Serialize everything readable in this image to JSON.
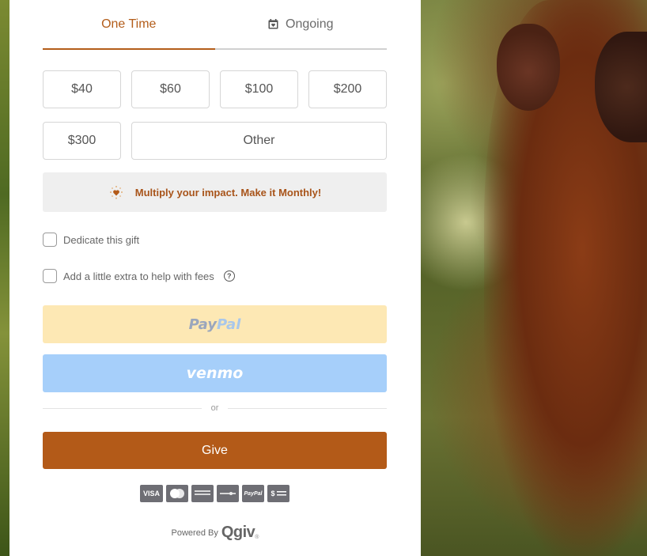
{
  "tabs": [
    {
      "label": "One Time",
      "active": true
    },
    {
      "label": "Ongoing",
      "icon": "calendar-heart-icon",
      "active": false
    }
  ],
  "amounts": [
    "$40",
    "$60",
    "$100",
    "$200",
    "$300"
  ],
  "other_label": "Other",
  "promo": {
    "text": "Multiply your impact. Make it Monthly!",
    "icon": "heart-sparkle-icon"
  },
  "options": {
    "dedicate_label": "Dedicate this gift",
    "fees_label": "Add a little extra to help with fees",
    "fees_help_icon": "question-circle-icon"
  },
  "paypal": {
    "part1": "Pay",
    "part2": "Pal"
  },
  "venmo_label": "venmo",
  "or_label": "or",
  "give_label": "Give",
  "payment_cards": [
    "VISA",
    "",
    "",
    "",
    "PayPal",
    "$"
  ],
  "powered": {
    "label": "Powered By",
    "brand": "Qgiv"
  },
  "colors": {
    "accent": "#b35a18",
    "paypal_bg": "#fde8b4",
    "venmo_bg": "#a6cffa"
  }
}
